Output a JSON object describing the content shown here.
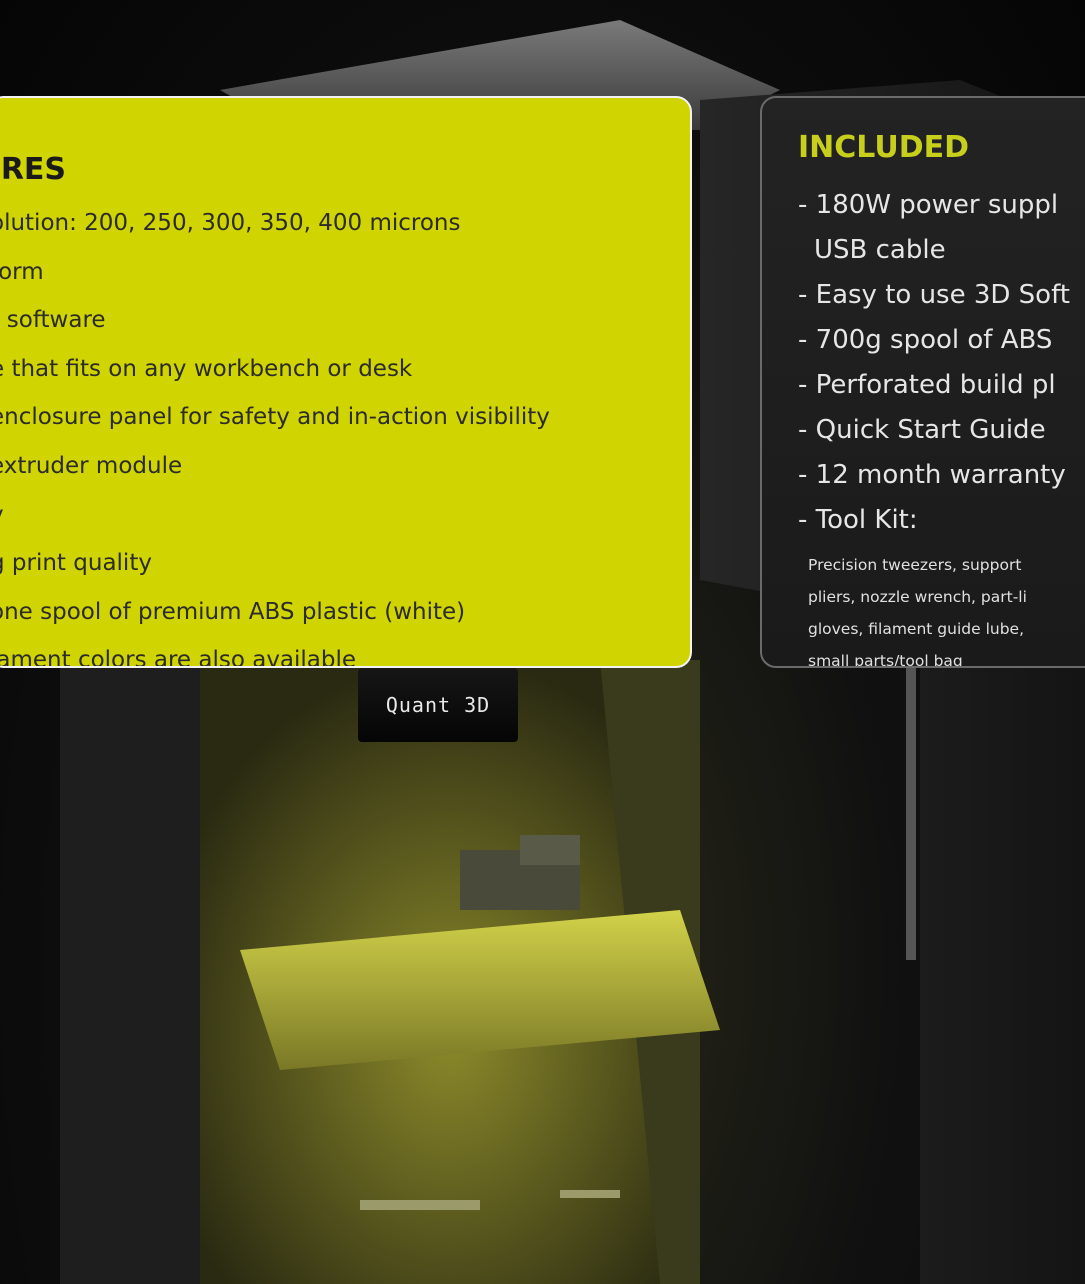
{
  "features": {
    "title": "TURES",
    "items": [
      "olution: 200, 250, 300, 350, 400 microns",
      "form",
      "r software",
      "e that fits on any workbench or desk",
      " enclosure panel for safety and in-action visibility",
      " extruder module",
      "y",
      "g print quality",
      " one spool of premium ABS plastic (white)",
      "lament colors are also available"
    ]
  },
  "included": {
    "title": "INCLUDED",
    "items": [
      {
        "line1": "- 180W power suppl",
        "line2": "USB cable"
      },
      {
        "line1": "- Easy to use 3D Soft"
      },
      {
        "line1": "- 700g spool of ABS"
      },
      {
        "line1": "- Perforated build pl"
      },
      {
        "line1": "- Quick Start Guide"
      },
      {
        "line1": "- 12 month warranty"
      },
      {
        "line1": "- Tool Kit:"
      }
    ],
    "toolkit_lines": [
      "Precision tweezers, support",
      "pliers, nozzle wrench, part-li",
      "gloves, filament guide lube,",
      "small parts/tool bag"
    ]
  },
  "product": {
    "logo_text": "Quant 3D"
  },
  "colors": {
    "accent_yellow": "#d0d400",
    "included_title": "#c7cf1c",
    "panel_dark": "#1f1f1f"
  }
}
